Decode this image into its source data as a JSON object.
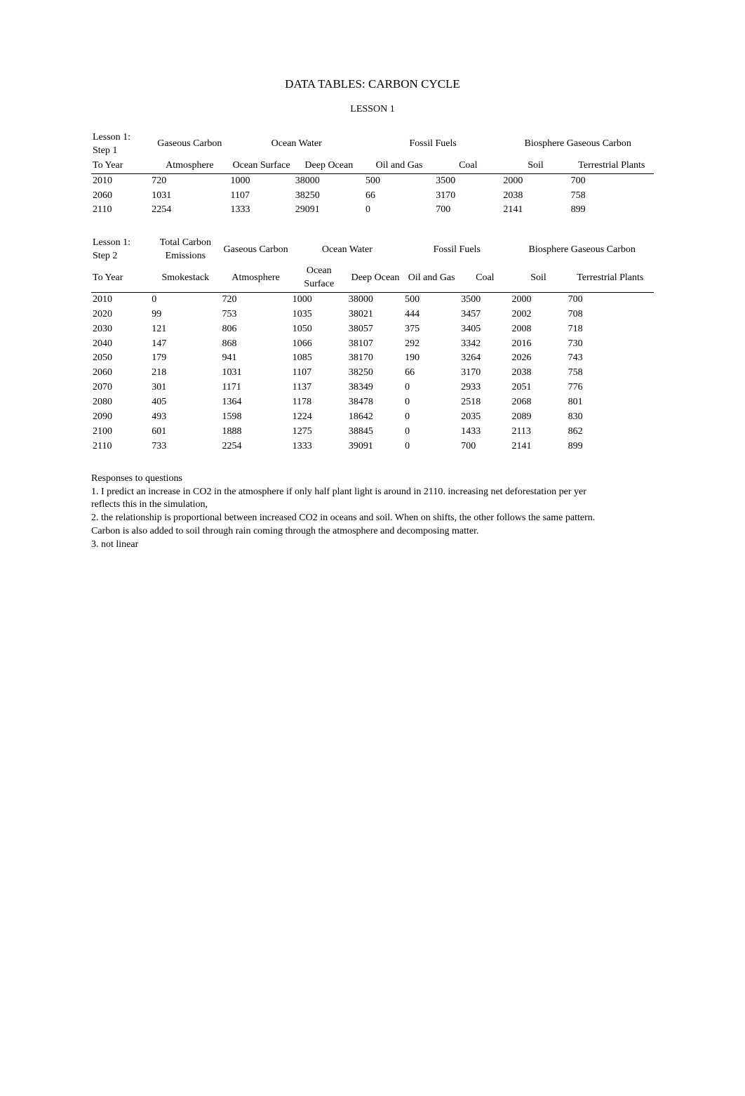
{
  "title": "DATA TABLES: CARBON CYCLE",
  "subtitle": "LESSON 1",
  "table1": {
    "corner1": "Lesson 1: Step 1",
    "corner2": "To Year",
    "groupHeaders": [
      "Gaseous Carbon",
      "Ocean Water",
      "Fossil Fuels",
      "Biosphere Gaseous Carbon"
    ],
    "subHeaders": [
      "Atmosphere",
      "Ocean Surface",
      "Deep Ocean",
      "Oil and Gas",
      "Coal",
      "Soil",
      "Terrestrial Plants"
    ],
    "rows": [
      [
        "2010",
        "720",
        "1000",
        "38000",
        "500",
        "3500",
        "2000",
        "700"
      ],
      [
        "2060",
        "1031",
        "1107",
        "38250",
        "66",
        "3170",
        "2038",
        "758"
      ],
      [
        "2110",
        "2254",
        "1333",
        "29091",
        "0",
        "700",
        "2141",
        "899"
      ]
    ]
  },
  "table2": {
    "corner1": "Lesson 1: Step 2",
    "corner2": "To Year",
    "groupHeaders": [
      "Total Carbon Emissions",
      "Gaseous Carbon",
      "Ocean Water",
      "Fossil Fuels",
      "Biosphere Gaseous Carbon"
    ],
    "subHeaders": [
      "Smokestack",
      "Atmosphere",
      "Ocean Surface",
      "Deep Ocean",
      "Oil and Gas",
      "Coal",
      "Soil",
      "Terrestrial Plants"
    ],
    "rows": [
      [
        "2010",
        "0",
        "720",
        "1000",
        "38000",
        "500",
        "3500",
        "2000",
        "700"
      ],
      [
        "2020",
        "99",
        "753",
        "1035",
        "38021",
        "444",
        "3457",
        "2002",
        "708"
      ],
      [
        "2030",
        "121",
        "806",
        "1050",
        "38057",
        "375",
        "3405",
        "2008",
        "718"
      ],
      [
        "2040",
        "147",
        "868",
        "1066",
        "38107",
        "292",
        "3342",
        "2016",
        "730"
      ],
      [
        "2050",
        "179",
        "941",
        "1085",
        "38170",
        "190",
        "3264",
        "2026",
        "743"
      ],
      [
        "2060",
        "218",
        "1031",
        "1107",
        "38250",
        "66",
        "3170",
        "2038",
        "758"
      ],
      [
        "2070",
        "301",
        "1171",
        "1137",
        "38349",
        "0",
        "2933",
        "2051",
        "776"
      ],
      [
        "2080",
        "405",
        "1364",
        "1178",
        "38478",
        "0",
        "2518",
        "2068",
        "801"
      ],
      [
        "2090",
        "493",
        "1598",
        "1224",
        "18642",
        "0",
        "2035",
        "2089",
        "830"
      ],
      [
        "2100",
        "601",
        "1888",
        "1275",
        "38845",
        "0",
        "1433",
        "2113",
        "862"
      ],
      [
        "2110",
        "733",
        "2254",
        "1333",
        "39091",
        "0",
        "700",
        "2141",
        "899"
      ]
    ]
  },
  "responses": {
    "heading": "Responses to questions",
    "p1": "1. I predict an increase in CO2 in the atmosphere if only half plant light is around in 2110. increasing net deforestation per yer reflects this in the simulation,",
    "p2": "2. the relationship is proportional between increased CO2 in oceans and soil. When on shifts, the other follows the same pattern. Carbon is also added to soil through rain coming through the atmosphere and decomposing matter.",
    "p3": "3. not linear"
  },
  "chart_data": [
    {
      "type": "table",
      "title": "Lesson 1: Step 1",
      "columns": [
        "To Year",
        "Atmosphere",
        "Ocean Surface",
        "Deep Ocean",
        "Oil and Gas",
        "Coal",
        "Soil",
        "Terrestrial Plants"
      ],
      "column_groups": {
        "Gaseous Carbon": [
          "Atmosphere"
        ],
        "Ocean Water": [
          "Ocean Surface",
          "Deep Ocean"
        ],
        "Fossil Fuels": [
          "Oil and Gas",
          "Coal"
        ],
        "Biosphere Gaseous Carbon": [
          "Soil",
          "Terrestrial Plants"
        ]
      },
      "rows": [
        {
          "To Year": 2010,
          "Atmosphere": 720,
          "Ocean Surface": 1000,
          "Deep Ocean": 38000,
          "Oil and Gas": 500,
          "Coal": 3500,
          "Soil": 2000,
          "Terrestrial Plants": 700
        },
        {
          "To Year": 2060,
          "Atmosphere": 1031,
          "Ocean Surface": 1107,
          "Deep Ocean": 38250,
          "Oil and Gas": 66,
          "Coal": 3170,
          "Soil": 2038,
          "Terrestrial Plants": 758
        },
        {
          "To Year": 2110,
          "Atmosphere": 2254,
          "Ocean Surface": 1333,
          "Deep Ocean": 29091,
          "Oil and Gas": 0,
          "Coal": 700,
          "Soil": 2141,
          "Terrestrial Plants": 899
        }
      ]
    },
    {
      "type": "table",
      "title": "Lesson 1: Step 2",
      "columns": [
        "To Year",
        "Smokestack",
        "Atmosphere",
        "Ocean Surface",
        "Deep Ocean",
        "Oil and Gas",
        "Coal",
        "Soil",
        "Terrestrial Plants"
      ],
      "column_groups": {
        "Total Carbon Emissions": [
          "Smokestack"
        ],
        "Gaseous Carbon": [
          "Atmosphere"
        ],
        "Ocean Water": [
          "Ocean Surface",
          "Deep Ocean"
        ],
        "Fossil Fuels": [
          "Oil and Gas",
          "Coal"
        ],
        "Biosphere Gaseous Carbon": [
          "Soil",
          "Terrestrial Plants"
        ]
      },
      "rows": [
        {
          "To Year": 2010,
          "Smokestack": 0,
          "Atmosphere": 720,
          "Ocean Surface": 1000,
          "Deep Ocean": 38000,
          "Oil and Gas": 500,
          "Coal": 3500,
          "Soil": 2000,
          "Terrestrial Plants": 700
        },
        {
          "To Year": 2020,
          "Smokestack": 99,
          "Atmosphere": 753,
          "Ocean Surface": 1035,
          "Deep Ocean": 38021,
          "Oil and Gas": 444,
          "Coal": 3457,
          "Soil": 2002,
          "Terrestrial Plants": 708
        },
        {
          "To Year": 2030,
          "Smokestack": 121,
          "Atmosphere": 806,
          "Ocean Surface": 1050,
          "Deep Ocean": 38057,
          "Oil and Gas": 375,
          "Coal": 3405,
          "Soil": 2008,
          "Terrestrial Plants": 718
        },
        {
          "To Year": 2040,
          "Smokestack": 147,
          "Atmosphere": 868,
          "Ocean Surface": 1066,
          "Deep Ocean": 38107,
          "Oil and Gas": 292,
          "Coal": 3342,
          "Soil": 2016,
          "Terrestrial Plants": 730
        },
        {
          "To Year": 2050,
          "Smokestack": 179,
          "Atmosphere": 941,
          "Ocean Surface": 1085,
          "Deep Ocean": 38170,
          "Oil and Gas": 190,
          "Coal": 3264,
          "Soil": 2026,
          "Terrestrial Plants": 743
        },
        {
          "To Year": 2060,
          "Smokestack": 218,
          "Atmosphere": 1031,
          "Ocean Surface": 1107,
          "Deep Ocean": 38250,
          "Oil and Gas": 66,
          "Coal": 3170,
          "Soil": 2038,
          "Terrestrial Plants": 758
        },
        {
          "To Year": 2070,
          "Smokestack": 301,
          "Atmosphere": 1171,
          "Ocean Surface": 1137,
          "Deep Ocean": 38349,
          "Oil and Gas": 0,
          "Coal": 2933,
          "Soil": 2051,
          "Terrestrial Plants": 776
        },
        {
          "To Year": 2080,
          "Smokestack": 405,
          "Atmosphere": 1364,
          "Ocean Surface": 1178,
          "Deep Ocean": 38478,
          "Oil and Gas": 0,
          "Coal": 2518,
          "Soil": 2068,
          "Terrestrial Plants": 801
        },
        {
          "To Year": 2090,
          "Smokestack": 493,
          "Atmosphere": 1598,
          "Ocean Surface": 1224,
          "Deep Ocean": 18642,
          "Oil and Gas": 0,
          "Coal": 2035,
          "Soil": 2089,
          "Terrestrial Plants": 830
        },
        {
          "To Year": 2100,
          "Smokestack": 601,
          "Atmosphere": 1888,
          "Ocean Surface": 1275,
          "Deep Ocean": 38845,
          "Oil and Gas": 0,
          "Coal": 1433,
          "Soil": 2113,
          "Terrestrial Plants": 862
        },
        {
          "To Year": 2110,
          "Smokestack": 733,
          "Atmosphere": 2254,
          "Ocean Surface": 1333,
          "Deep Ocean": 39091,
          "Oil and Gas": 0,
          "Coal": 700,
          "Soil": 2141,
          "Terrestrial Plants": 899
        }
      ]
    }
  ]
}
